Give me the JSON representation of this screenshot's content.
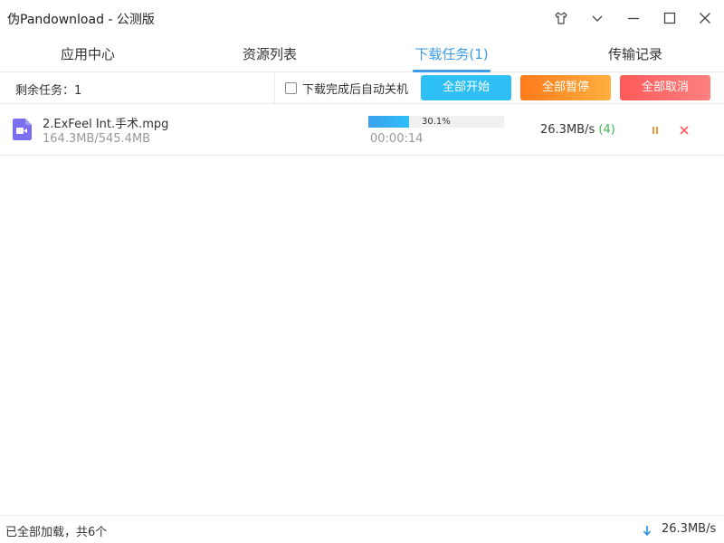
{
  "window": {
    "title": "伪Pandownload - 公测版"
  },
  "tabs": [
    {
      "label": "应用中心",
      "active": false
    },
    {
      "label": "资源列表",
      "active": false
    },
    {
      "label": "下载任务(1)",
      "active": true
    },
    {
      "label": "传输记录",
      "active": false
    }
  ],
  "toolbar": {
    "remaining": "剩余任务：1",
    "auto_shutdown_label": "下载完成后自动关机",
    "auto_shutdown_checked": false,
    "start_all": "全部开始",
    "pause_all": "全部暂停",
    "cancel_all": "全部取消"
  },
  "tasks": [
    {
      "name": "2.ExFeel Int.手术.mpg",
      "size": "164.3MB/545.4MB",
      "progress_percent": 30.1,
      "progress_text": "30.1%",
      "elapsed": "00:00:14",
      "speed": "26.3MB/s",
      "connections": "(4)"
    }
  ],
  "statusbar": {
    "text": "已全部加载，共6个",
    "speed": "26.3MB/s"
  },
  "colors": {
    "accent": "#3e9de8",
    "start": "#2ec0f5",
    "pause": "#ff8c2a",
    "cancel": "#ff6464",
    "connections": "#3cba54",
    "file_icon": "#7b6ff0"
  },
  "icons": {
    "skin": "tshirt-icon",
    "menu": "chevron-down-icon",
    "minimize": "minimize-icon",
    "maximize": "maximize-icon",
    "close": "close-icon",
    "file": "video-file-icon",
    "row_pause": "pause-icon",
    "row_cancel": "cancel-icon",
    "status_download": "download-arrow-icon"
  }
}
